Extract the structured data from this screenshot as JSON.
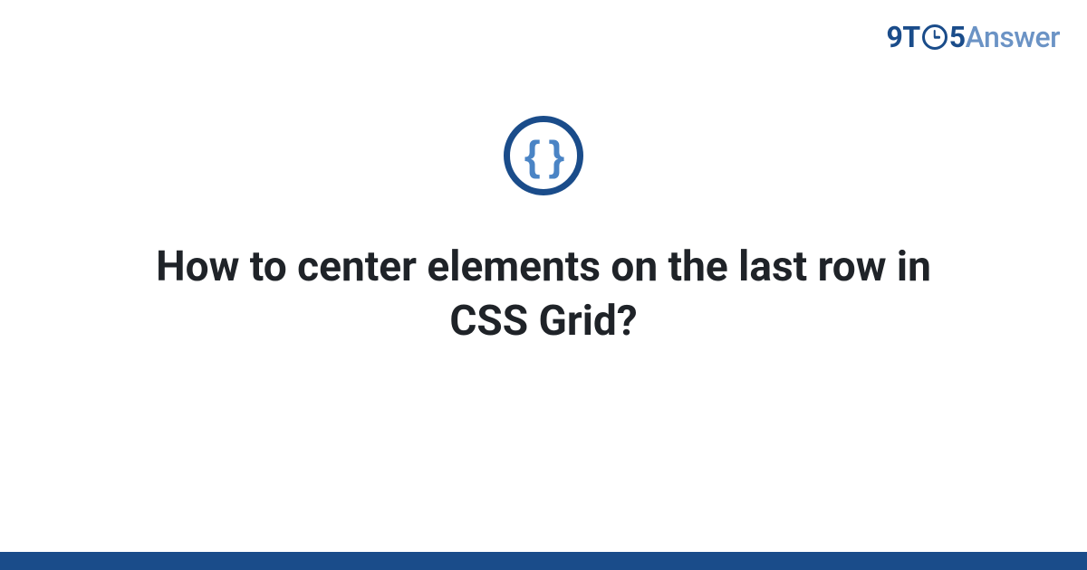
{
  "brand": {
    "part1": "9T",
    "part2": "5",
    "part3": "Answer"
  },
  "icon": {
    "name": "braces-icon",
    "glyph": "{ }"
  },
  "title": "How to center elements on the last row in CSS Grid?",
  "colors": {
    "primary": "#1a4c8a",
    "secondary": "#4a84c5",
    "brand_light": "#6b93c5",
    "text": "#1f2328"
  }
}
